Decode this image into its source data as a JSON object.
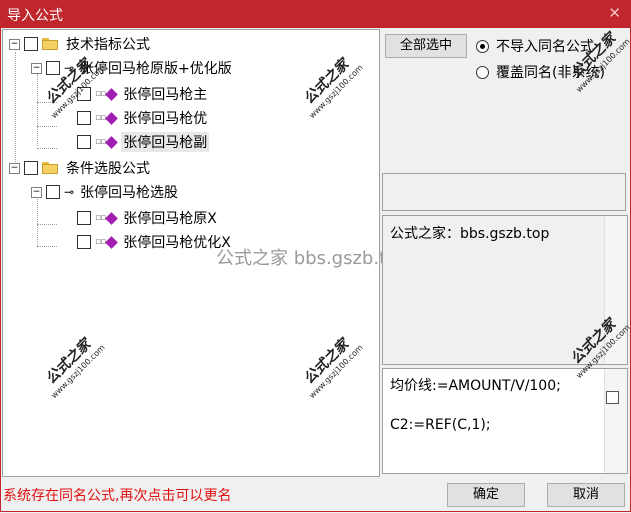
{
  "window": {
    "title": "导入公式",
    "close_glyph": "✕"
  },
  "tree": {
    "groups": [
      {
        "expander": "−",
        "label": "技术指标公式",
        "sub": {
          "expander": "−",
          "label": "张停回马枪原版+优化版",
          "items": [
            "张停回马枪主",
            "张停回马枪优",
            "张停回马枪副"
          ]
        }
      },
      {
        "expander": "−",
        "label": "条件选股公式",
        "sub": {
          "expander": "−",
          "label": "张停回马枪选股",
          "items": [
            "张停回马枪原X",
            "张停回马枪优化X"
          ]
        }
      }
    ],
    "selected_item": "张停回马枪副"
  },
  "watermarks": {
    "main": "公式之家",
    "sub": "www.gszj100.com",
    "center": "公式之家 bbs.gszb.top"
  },
  "controls": {
    "select_all_label": "全部选中",
    "radio_options": [
      {
        "label": "不导入同名公式",
        "checked": true
      },
      {
        "label": "覆盖同名(非系统)",
        "checked": false
      }
    ]
  },
  "description": "公式之家：bbs.gszb.top",
  "code_lines": [
    "均价线:=AMOUNT/V/100;",
    "C2:=REF(C,1);"
  ],
  "status_message": "系统存在同名公式,再次点击可以更名",
  "buttons": {
    "ok": "确定",
    "cancel": "取消"
  },
  "colors": {
    "titlebar": "#c0272d",
    "status_text": "#e01010",
    "formula_icon": "#a01fb0"
  }
}
